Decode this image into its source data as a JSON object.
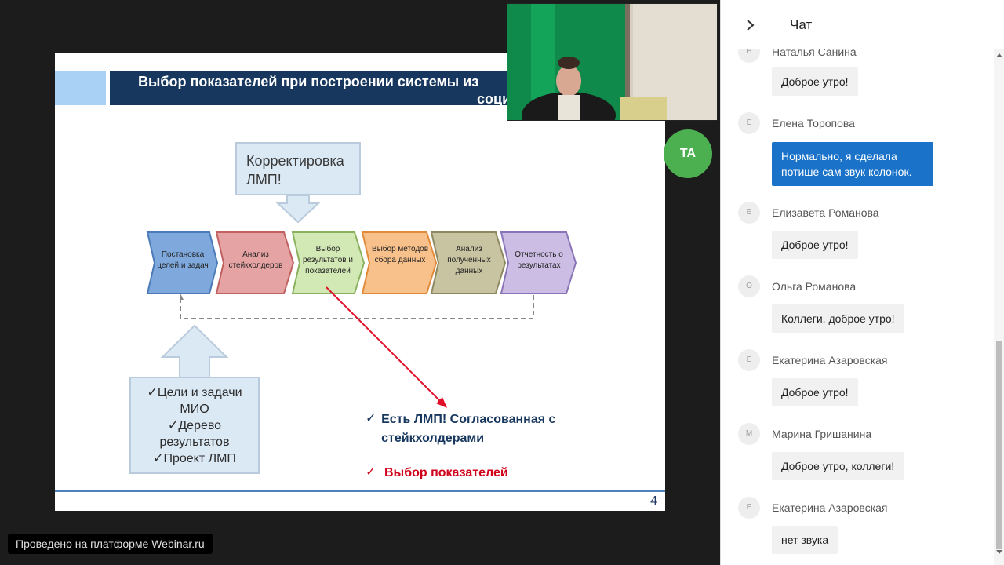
{
  "slide": {
    "title_line1": "Выбор показателей при построении системы из",
    "title_line2": "социал",
    "callout_top": "Корректировка ЛМП!",
    "chevrons": [
      {
        "label": "Постановка целей и задач",
        "color": "#6f9fd8"
      },
      {
        "label": "Анализ стейкхолдеров",
        "color": "#e6a3a3"
      },
      {
        "label": "Выбор результатов и показателей",
        "color": "#c6e0a8"
      },
      {
        "label": "Выбор методов сбора данных",
        "color": "#f8c08a"
      },
      {
        "label": "Анализ полученных данных",
        "color": "#c8c3a0"
      },
      {
        "label": "Отчетность о результатах",
        "color": "#c3b4de"
      }
    ],
    "callout_bottom": [
      "✓Цели и задачи",
      "МИО",
      "✓Дерево",
      "результатов",
      "✓Проект ЛМП"
    ],
    "checks": [
      {
        "mark": "✓",
        "text": "Есть ЛМП! Согласованная с стейкхолдерами",
        "color": "#17375e"
      },
      {
        "mark": "✓",
        "text": "Выбор показателей",
        "color": "#d0021b"
      }
    ],
    "page_number": "4"
  },
  "presenter": {
    "initials": "TA",
    "color": "#4caf50"
  },
  "platform_badge": "Проведено на платформе Webinar.ru",
  "chat": {
    "title": "Чат",
    "partial_name": "Наталья Санина",
    "messages": [
      {
        "initial": "",
        "name": "",
        "text": "Доброе утро!",
        "highlight": false
      },
      {
        "initial": "Е",
        "name": "Елена Торопова",
        "text": "Нормально, я сделала потише сам звук колонок.",
        "highlight": true
      },
      {
        "initial": "Е",
        "name": "Елизавета Романова",
        "text": "Доброе утро!",
        "highlight": false
      },
      {
        "initial": "О",
        "name": "Ольга Романова",
        "text": "Коллеги, доброе утро!",
        "highlight": false
      },
      {
        "initial": "Е",
        "name": "Екатерина Азаровская",
        "text": "Доброе утро!",
        "highlight": false
      },
      {
        "initial": "М",
        "name": "Марина Гришанина",
        "text": "Доброе утро, коллеги!",
        "highlight": false
      },
      {
        "initial": "Е",
        "name": "Екатерина Азаровская",
        "text": "нет звука",
        "highlight": false
      }
    ]
  }
}
